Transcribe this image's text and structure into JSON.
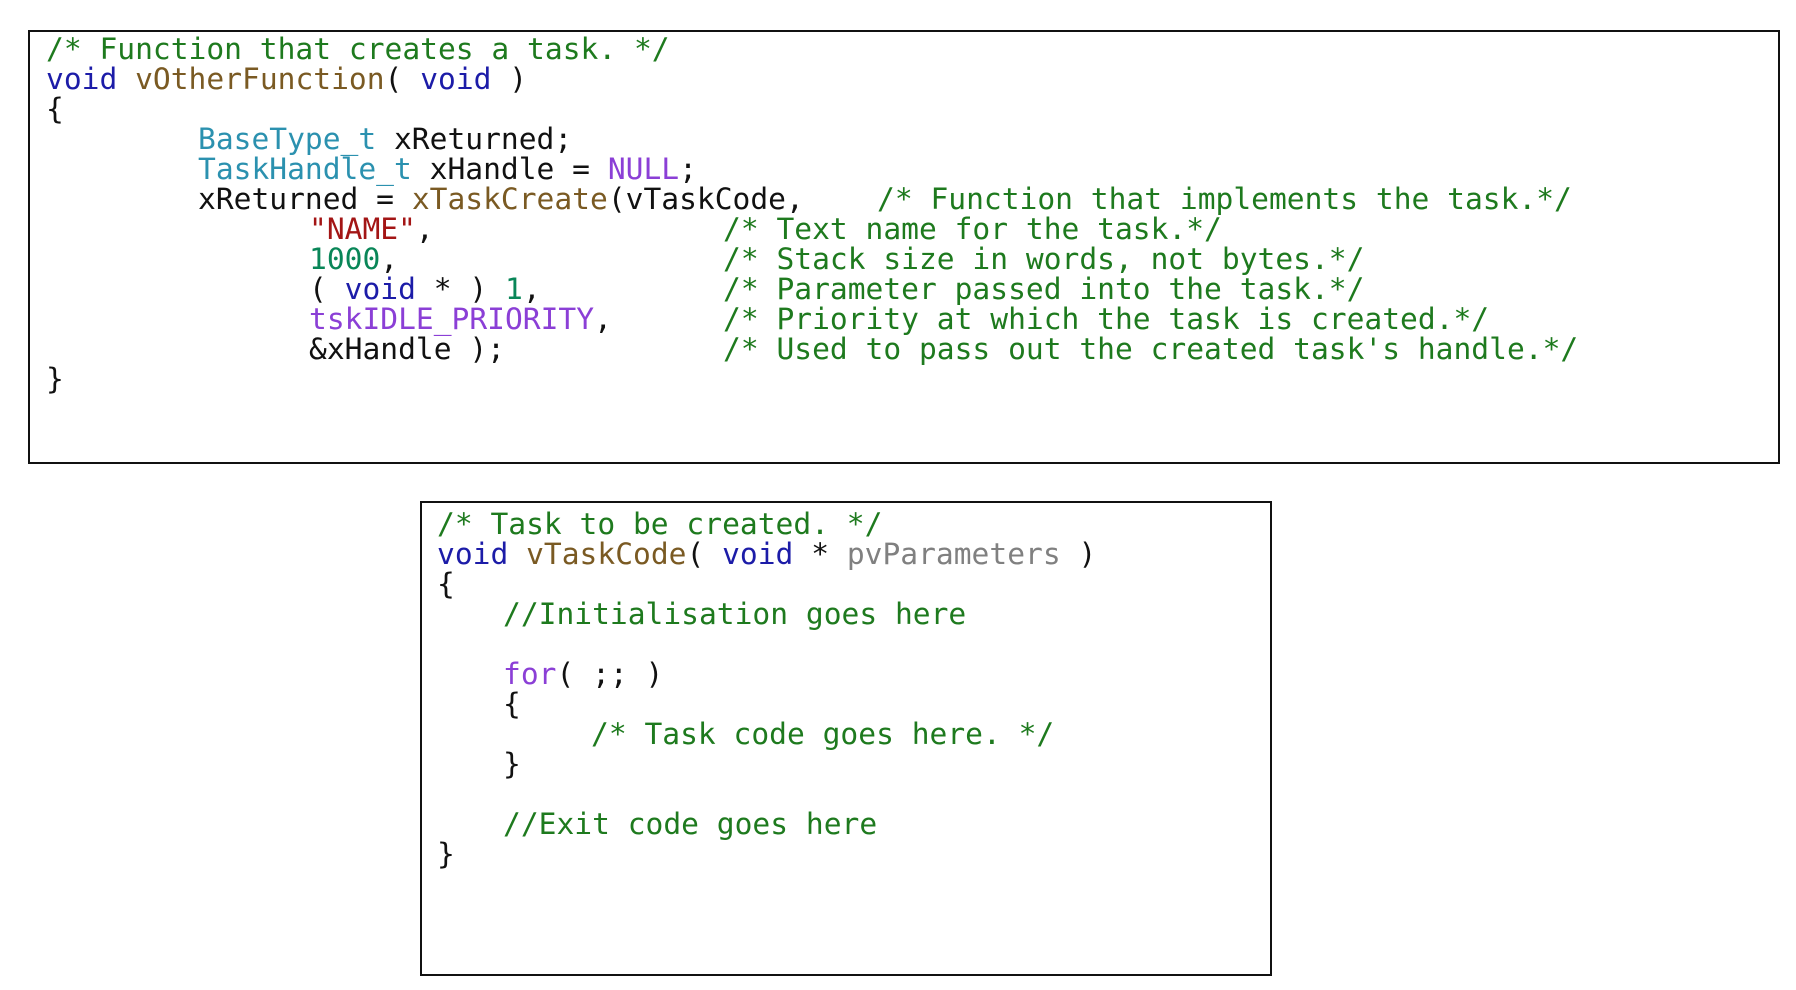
{
  "colors": {
    "comment": "#1e7a1e",
    "keyword": "#1c1ca8",
    "function": "#7a5a23",
    "type": "#2b91af",
    "macro": "#8b3fd6",
    "string": "#a31515",
    "number": "#098658",
    "parameter": "#808080",
    "plain": "#111111",
    "border": "#111111",
    "background": "#ffffff"
  },
  "snippet_1": {
    "lines": [
      [
        [
          "comment",
          "/* Function that creates a task. */"
        ]
      ],
      [
        [
          "keyword",
          "void"
        ],
        [
          "plain",
          " "
        ],
        [
          "function",
          "vOtherFunction"
        ],
        [
          "plain",
          "( "
        ],
        [
          "keyword",
          "void"
        ],
        [
          "plain",
          " )"
        ]
      ],
      [
        [
          "plain",
          "{"
        ]
      ],
      [
        [
          "type",
          "BaseType_t"
        ],
        [
          "plain",
          " xReturned;"
        ]
      ],
      [
        [
          "type",
          "TaskHandle_t"
        ],
        [
          "plain",
          " xHandle = "
        ],
        [
          "macro",
          "NULL"
        ],
        [
          "plain",
          ";"
        ]
      ],
      [
        [
          "plain",
          "xReturned = "
        ],
        [
          "function",
          "xTaskCreate"
        ],
        [
          "plain",
          "(vTaskCode,"
        ]
      ],
      [
        [
          "string",
          "\"NAME\""
        ],
        [
          "plain",
          ","
        ]
      ],
      [
        [
          "number",
          "1000"
        ],
        [
          "plain",
          ","
        ]
      ],
      [
        [
          "plain",
          "( "
        ],
        [
          "keyword",
          "void"
        ],
        [
          "plain",
          " * ) "
        ],
        [
          "number",
          "1"
        ],
        [
          "plain",
          ","
        ]
      ],
      [
        [
          "macro",
          "tskIDLE_PRIORITY"
        ],
        [
          "plain",
          ","
        ]
      ],
      [
        [
          "plain",
          "&xHandle );"
        ]
      ],
      [
        [
          "plain",
          "}"
        ]
      ]
    ],
    "comments": [
      "/* Function that implements the task.*/",
      "/* Text name for the task.*/",
      "/* Stack size in words, not bytes.*/",
      "/* Parameter passed into the task.*/",
      "/* Priority at which the task is created.*/",
      "/* Used to pass out the created task's handle.*/"
    ]
  },
  "snippet_2": {
    "lines": [
      [
        [
          "comment",
          "/* Task to be created. */"
        ]
      ],
      [
        [
          "keyword",
          "void"
        ],
        [
          "plain",
          " "
        ],
        [
          "function",
          "vTaskCode"
        ],
        [
          "plain",
          "( "
        ],
        [
          "keyword",
          "void"
        ],
        [
          "plain",
          " * "
        ],
        [
          "param",
          "pvParameters"
        ],
        [
          "plain",
          " )"
        ]
      ],
      [
        [
          "plain",
          "{"
        ]
      ],
      [
        [
          "comment",
          "//Initialisation goes here"
        ]
      ],
      [
        [
          "macro",
          "for"
        ],
        [
          "plain",
          "( ;; )"
        ]
      ],
      [
        [
          "plain",
          "{"
        ]
      ],
      [
        [
          "comment",
          "/* Task code goes here. */"
        ]
      ],
      [
        [
          "plain",
          "}"
        ]
      ],
      [
        [
          "comment",
          "//Exit code goes here"
        ]
      ],
      [
        [
          "plain",
          "}"
        ]
      ]
    ]
  }
}
